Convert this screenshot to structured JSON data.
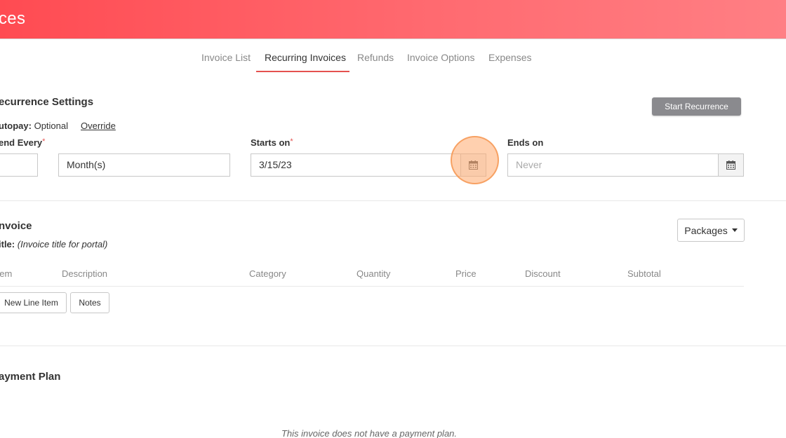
{
  "header": {
    "title": "ces"
  },
  "tabs": [
    {
      "label": "Invoice List",
      "active": false
    },
    {
      "label": "Recurring Invoices",
      "active": true
    },
    {
      "label": "Refunds",
      "active": false
    },
    {
      "label": "Invoice Options",
      "active": false
    },
    {
      "label": "Expenses",
      "active": false
    }
  ],
  "recurrence": {
    "title": "ecurrence Settings",
    "start_button": "Start Recurrence",
    "autopay_label": "utopay:",
    "autopay_value": "Optional",
    "override_link": "Override",
    "send_every_label": "end Every",
    "required_mark": "*",
    "send_every_count": "",
    "send_every_unit": "Month(s)",
    "starts_on_label": "Starts on",
    "starts_on_value": "3/15/23",
    "ends_on_label": "Ends on",
    "ends_on_placeholder": "Never"
  },
  "invoice": {
    "title": "nvoice",
    "title_label": "itle:",
    "title_placeholder": "(Invoice title for portal)",
    "packages_button": "Packages",
    "columns": [
      "Item",
      "Description",
      "Category",
      "Quantity",
      "Price",
      "Discount",
      "Subtotal"
    ],
    "new_line_item_button": "New Line Item",
    "notes_button": "Notes"
  },
  "payment_plan": {
    "title": "ayment Plan",
    "empty_text": "This invoice does not have a payment plan."
  },
  "colors": {
    "header": "#ff4b52",
    "accent": "#e5514f",
    "gray_button": "#8a8a8e"
  }
}
